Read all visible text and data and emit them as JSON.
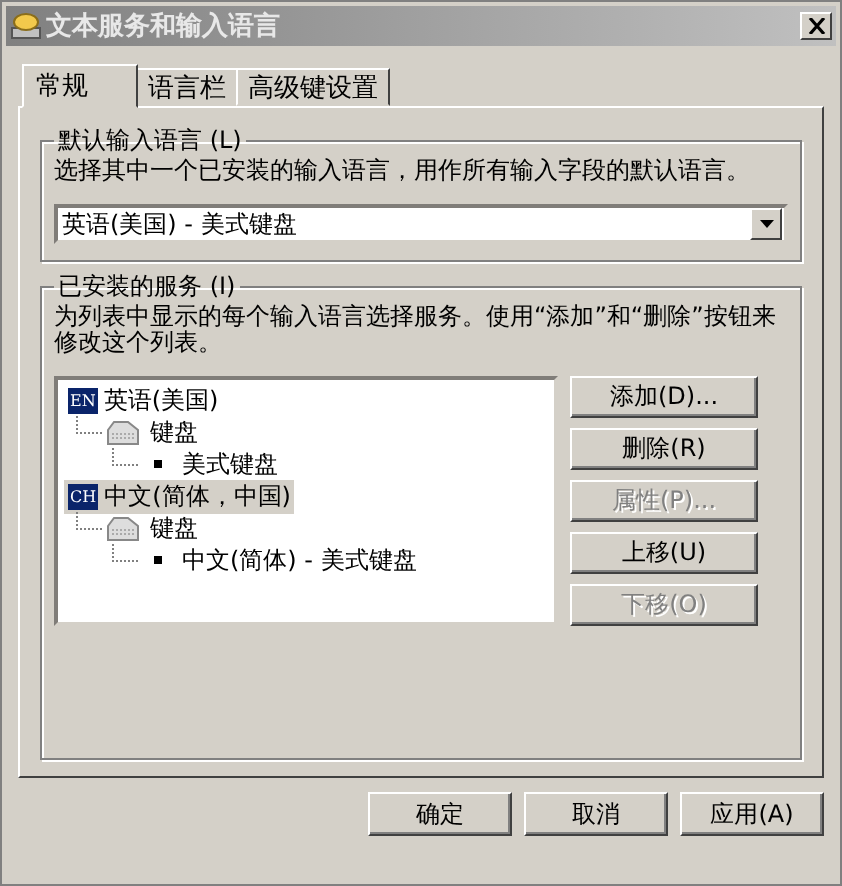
{
  "window": {
    "title": "文本服务和输入语言"
  },
  "tabs": [
    {
      "label": "常规",
      "selected": true
    },
    {
      "label": "语言栏",
      "selected": false
    },
    {
      "label": "高级键设置",
      "selected": false
    }
  ],
  "default_language": {
    "legend": "默认输入语言 (L)",
    "description": "选择其中一个已安装的输入语言，用作所有输入字段的默认语言。",
    "value": "英语(美国) - 美式键盘"
  },
  "installed_services": {
    "legend": "已安装的服务 (I)",
    "description": "为列表中显示的每个输入语言选择服务。使用“添加”和“删除”按钮来修改这个列表。",
    "tree": [
      {
        "kind": "language",
        "badge": "EN",
        "label": "英语(美国)",
        "selected": false,
        "children": [
          {
            "kind": "category",
            "label": "键盘",
            "selected": false,
            "children": [
              {
                "kind": "service",
                "label": "美式键盘",
                "selected": false
              }
            ]
          }
        ]
      },
      {
        "kind": "language",
        "badge": "CH",
        "label": "中文(简体，中国)",
        "selected": true,
        "children": [
          {
            "kind": "category",
            "label": "键盘",
            "selected": false,
            "children": [
              {
                "kind": "service",
                "label": "中文(简体) - 美式键盘",
                "selected": false
              }
            ]
          }
        ]
      }
    ],
    "buttons": [
      {
        "label": "添加(D)...",
        "disabled": false
      },
      {
        "label": "删除(R)",
        "disabled": false
      },
      {
        "label": "属性(P)...",
        "disabled": true
      },
      {
        "label": "上移(U)",
        "disabled": false
      },
      {
        "label": "下移(O)",
        "disabled": true
      }
    ]
  },
  "dialog_buttons": [
    {
      "label": "确定",
      "disabled": false
    },
    {
      "label": "取消",
      "disabled": false
    },
    {
      "label": "应用(A)",
      "disabled": false
    }
  ]
}
